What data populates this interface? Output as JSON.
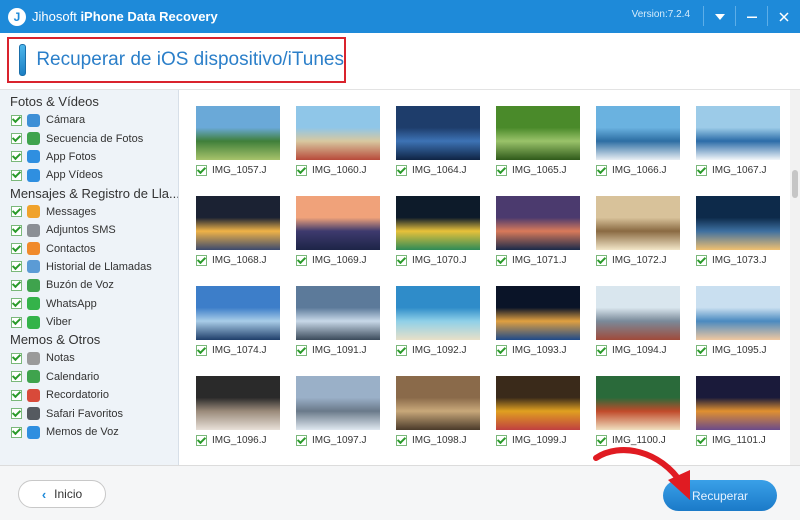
{
  "window": {
    "brand_light": "Jihosoft",
    "brand_bold": "iPhone Data Recovery",
    "version": "Version:7.2.4",
    "logo_letter": "J",
    "accent_color": "#1e8ad9"
  },
  "header": {
    "mode_title": "Recuperar de iOS dispositivo/iTunes",
    "highlight_color": "#d9232d"
  },
  "sidebar": {
    "categories": [
      {
        "title": "Fotos & Vídeos",
        "items": [
          {
            "label": "Cámara",
            "icon": "camera-icon",
            "color": "#3d8fd6"
          },
          {
            "label": "Secuencia de Fotos",
            "icon": "photo-stream-icon",
            "color": "#3fa34d"
          },
          {
            "label": "App Fotos",
            "icon": "app-photos-icon",
            "color": "#2f8fe0"
          },
          {
            "label": "App Vídeos",
            "icon": "app-videos-icon",
            "color": "#2f8fe0"
          }
        ]
      },
      {
        "title": "Mensajes & Registro de Lla...",
        "items": [
          {
            "label": "Messages",
            "icon": "messages-icon",
            "color": "#f0a22b"
          },
          {
            "label": "Adjuntos SMS",
            "icon": "attachment-icon",
            "color": "#8b8f95"
          },
          {
            "label": "Contactos",
            "icon": "contacts-icon",
            "color": "#f08a2b"
          },
          {
            "label": "Historial de Llamadas",
            "icon": "call-history-icon",
            "color": "#5b9bd5"
          },
          {
            "label": "Buzón de Voz",
            "icon": "voicemail-icon",
            "color": "#3fa34d"
          },
          {
            "label": "WhatsApp",
            "icon": "whatsapp-icon",
            "color": "#34b34a"
          },
          {
            "label": "Viber",
            "icon": "viber-icon",
            "color": "#34b34a"
          }
        ]
      },
      {
        "title": "Memos & Otros",
        "items": [
          {
            "label": "Notas",
            "icon": "notes-icon",
            "color": "#9a9a9a"
          },
          {
            "label": "Calendario",
            "icon": "calendar-icon",
            "color": "#3fa34d"
          },
          {
            "label": "Recordatorio",
            "icon": "reminder-icon",
            "color": "#d84a3a"
          },
          {
            "label": "Safari Favoritos",
            "icon": "safari-bookmarks-icon",
            "color": "#555a60"
          },
          {
            "label": "Memos de Voz",
            "icon": "voice-memos-icon",
            "color": "#2f8fe0"
          }
        ]
      }
    ]
  },
  "photos": [
    [
      "IMG_1057.J",
      "IMG_1060.J",
      "IMG_1064.J",
      "IMG_1065.J",
      "IMG_1066.J",
      "IMG_1067.J"
    ],
    [
      "IMG_1068.J",
      "IMG_1069.J",
      "IMG_1070.J",
      "IMG_1071.J",
      "IMG_1072.J",
      "IMG_1073.J"
    ],
    [
      "IMG_1074.J",
      "IMG_1091.J",
      "IMG_1092.J",
      "IMG_1093.J",
      "IMG_1094.J",
      "IMG_1095.J"
    ],
    [
      "IMG_1096.J",
      "IMG_1097.J",
      "IMG_1098.J",
      "IMG_1099.J",
      "IMG_1100.J",
      "IMG_1101.J"
    ]
  ],
  "footer": {
    "back_label": "Inicio",
    "recover_label": "Recuperar"
  }
}
